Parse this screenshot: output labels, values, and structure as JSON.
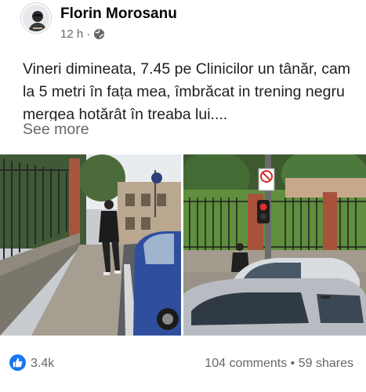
{
  "post": {
    "author": "Florin Morosanu",
    "time": "12 h",
    "separator": "·",
    "privacy_icon": "globe-icon",
    "text": "Vineri dimineata, 7.45 pe Clinicilor un tânăr, cam la 5 metri în fața mea, îmbrăcat in trening negru mergea hotărât în treaba lui....",
    "see_more": "See more"
  },
  "footer": {
    "reaction_icon": "like-icon",
    "reaction_count": "3.4k",
    "comments_shares": "104 comments • 59 shares"
  },
  "colors": {
    "brand": "#1877f2",
    "secondary_text": "#65676b",
    "primary_text": "#050505"
  }
}
